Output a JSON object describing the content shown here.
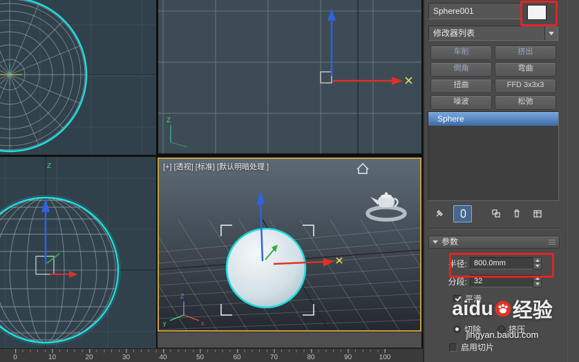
{
  "viewports": {
    "perspective_label": "[+] [透视] [标准] [默认明暗处理 ]",
    "axis_labels": {
      "x": "x",
      "y": "y",
      "z": "Z"
    }
  },
  "timeline": {
    "numbers": [
      "0",
      "10",
      "20",
      "30",
      "40",
      "50",
      "60",
      "70",
      "80",
      "90",
      "100"
    ]
  },
  "panel": {
    "object_name": "Sphere001",
    "modifier_list_label": "修改器列表",
    "modifier_buttons": [
      {
        "label": "车削"
      },
      {
        "label": "挤出"
      },
      {
        "label": "倒角"
      },
      {
        "label": "弯曲"
      },
      {
        "label": "扭曲"
      },
      {
        "label": "FFD 3x3x3"
      },
      {
        "label": "噪波"
      },
      {
        "label": "松弛"
      }
    ],
    "stack_items": [
      {
        "label": "Sphere"
      }
    ],
    "icon_names": [
      "pin-stack-icon",
      "show-end-result-icon",
      "make-unique-icon",
      "remove-modifier-icon",
      "configure-modifier-sets-icon"
    ],
    "rollout_title": "参数",
    "params": {
      "radius_label": "半径:",
      "radius_value": "800.0mm",
      "segments_label": "分段:",
      "segments_value": "32",
      "smooth_label": "平滑",
      "chop_label": "切除",
      "squash_label": "挤压",
      "slice_label": "启用切片"
    }
  },
  "watermark": {
    "text_left": "ai",
    "text_mid": "du",
    "text_right": "经验",
    "url": "jingyan.baidu.com"
  },
  "colors": {
    "selection_cyan": "#17e2e2",
    "active_viewport_border": "#c9a240",
    "stack_selected_blue": "#4e7cb4",
    "annotation_red": "#e42424",
    "gizmo_x_red": "#de3226",
    "gizmo_y_green": "#2fae4a",
    "gizmo_z_blue": "#2f62e0",
    "axis_label_yellow": "#e2e24c"
  }
}
